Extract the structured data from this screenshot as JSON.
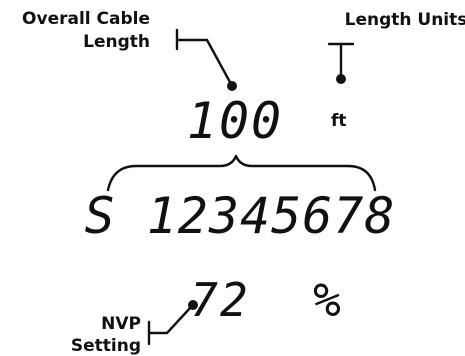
{
  "callouts": {
    "overall_cable_length": [
      "Overall Cable",
      "Length"
    ],
    "length_units": "Length Units",
    "nvp_setting": [
      "NVP",
      "Setting"
    ]
  },
  "display": {
    "length_value": "100",
    "length_unit": "ft",
    "wire_pairs": "S 12345678",
    "nvp_value": "72",
    "percent_symbol": "%"
  },
  "colors": {
    "ink": "#111111",
    "background": "#ffffff"
  }
}
